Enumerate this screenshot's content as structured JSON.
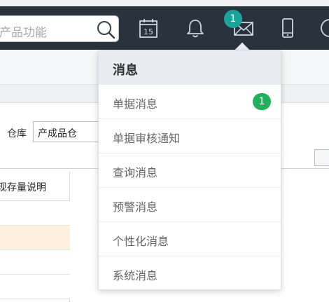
{
  "topbar": {
    "search_placeholder": "产品功能",
    "icons": [
      "search-icon",
      "calendar-icon",
      "bell-icon",
      "mail-icon",
      "mobile-icon",
      "help-icon"
    ],
    "calendar_day": "15",
    "mail_badge": "1",
    "colors": {
      "bar": "#28333e",
      "badge": "#19a59a"
    }
  },
  "form": {
    "warehouse_label": "仓库",
    "warehouse_value": "产成品仓"
  },
  "grid": {
    "header": "现存量说明"
  },
  "dropdown": {
    "title": "消息",
    "items": [
      {
        "label": "单据消息",
        "badge": "1"
      },
      {
        "label": "单据审核通知"
      },
      {
        "label": "查询消息"
      },
      {
        "label": "预警消息"
      },
      {
        "label": "个性化消息"
      },
      {
        "label": "系统消息"
      }
    ],
    "colors": {
      "header": "#e9edf2",
      "badge": "#1fb25a"
    }
  }
}
